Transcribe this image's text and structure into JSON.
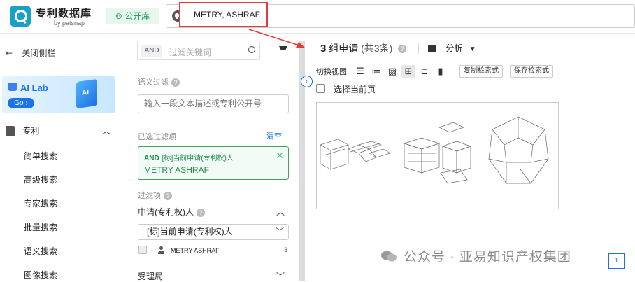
{
  "topbar": {
    "brand_title": "专利数据库",
    "brand_sub": "by patsnap",
    "open_db": "公开库",
    "search_value": "METRY, ASHRAF"
  },
  "leftnav": {
    "collapse_label": "关闭侧栏",
    "ailab_title": "AI Lab",
    "ailab_go": "Go ›",
    "ailab_cube": "AI",
    "section_label": "专利",
    "items": [
      "简单搜索",
      "高级搜索",
      "专家搜索",
      "批量搜索",
      "语义搜索",
      "图像搜索"
    ]
  },
  "filter": {
    "and_tag": "AND",
    "search_placeholder": "过滤关键词",
    "semantic_label": "语义过滤",
    "semantic_placeholder": "输入一段文本描述或专利公开号",
    "selected_label": "已选过滤项",
    "clear_label": "清空",
    "chosen_and": "AND",
    "chosen_field": "[标]当前申请(专利权)人",
    "chosen_value": "METRY ASHRAF",
    "filters_label": "过滤项",
    "applicant_heading": "申请(专利权)人",
    "dropdown_value": "[标]当前申请(专利权)人",
    "person_name": "METRY ASHRAF",
    "person_count": "3",
    "shouli_label": "受理局"
  },
  "main": {
    "count": "3",
    "title_text": "组申请",
    "title_sub": "(共3条)",
    "analysis_label": "分析",
    "view_switch_label": "切换视图",
    "copy_query": "复制检索式",
    "save_query": "保存检索式",
    "select_page_label": "选择当前页",
    "page_number": "1"
  },
  "watermark": "公众号 · 亚易知识产权集团",
  "colors": {
    "accent_blue": "#1a73e8",
    "green": "#1e9e55",
    "highlight_red": "#e53935"
  }
}
